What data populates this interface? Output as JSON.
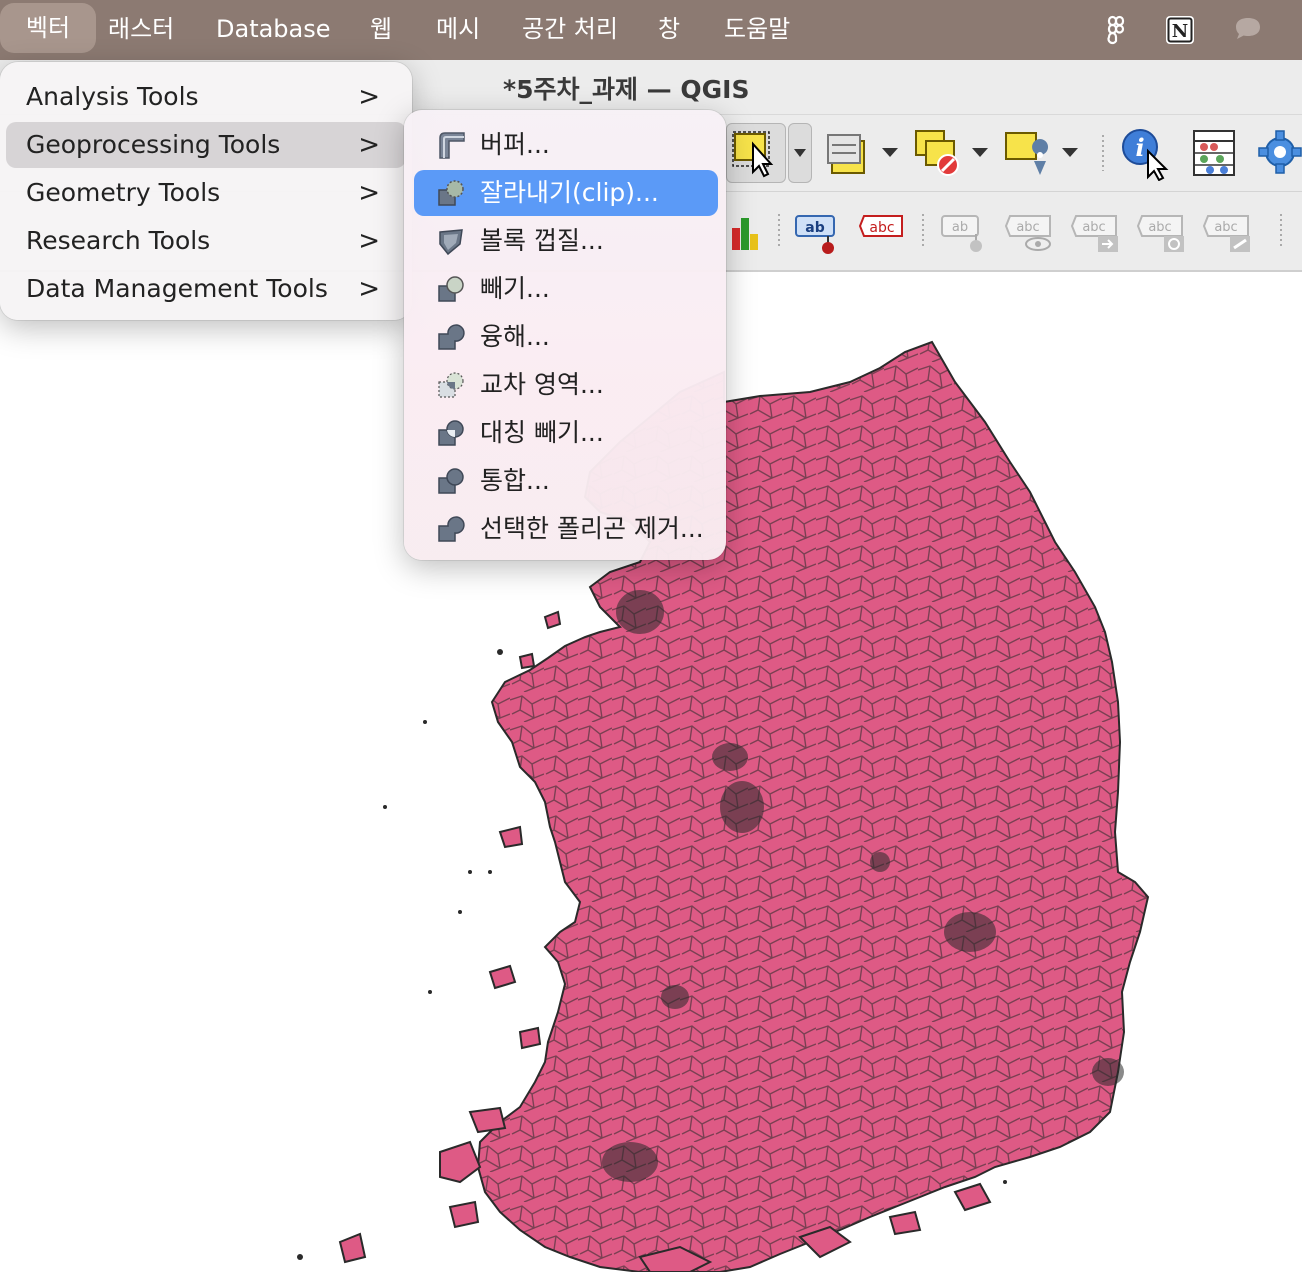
{
  "menubar": {
    "items": [
      {
        "label": "벡터",
        "active": true
      },
      {
        "label": "래스터"
      },
      {
        "label": "Database"
      },
      {
        "label": "웹"
      },
      {
        "label": "메시"
      },
      {
        "label": "공간 처리"
      },
      {
        "label": "창"
      },
      {
        "label": "도움말"
      }
    ],
    "right_icons": [
      "figma-icon",
      "notion-icon",
      "chat-bubble-icon"
    ]
  },
  "window": {
    "title": "*5주차_과제 — QGIS"
  },
  "vector_menu": {
    "items": [
      {
        "label": "Analysis Tools",
        "submenu": true
      },
      {
        "label": "Geoprocessing Tools",
        "submenu": true,
        "highlighted": true
      },
      {
        "label": "Geometry Tools",
        "submenu": true
      },
      {
        "label": "Research Tools",
        "submenu": true
      },
      {
        "label": "Data Management Tools",
        "submenu": true
      }
    ],
    "chevron": ">"
  },
  "geoprocessing_menu": {
    "items": [
      {
        "label": "버퍼...",
        "icon": "buffer-icon"
      },
      {
        "label": "잘라내기(clip)...",
        "icon": "clip-icon",
        "selected": true
      },
      {
        "label": "볼록 껍질...",
        "icon": "convex-hull-icon"
      },
      {
        "label": "빼기...",
        "icon": "difference-icon"
      },
      {
        "label": "융해...",
        "icon": "dissolve-icon"
      },
      {
        "label": "교차 영역...",
        "icon": "intersection-icon"
      },
      {
        "label": "대칭 빼기...",
        "icon": "symmetrical-difference-icon"
      },
      {
        "label": "통합...",
        "icon": "union-icon"
      },
      {
        "label": "선택한 폴리곤 제거...",
        "icon": "eliminate-polygons-icon"
      }
    ]
  },
  "toolbar2": {
    "label_icons": [
      "ab",
      "abc",
      "ab",
      "abc",
      "abc",
      "abc",
      "abc"
    ]
  },
  "colors": {
    "menubar_bg": "#8c7a72",
    "selection": "#5b9af7",
    "map_fill": "#de5a85",
    "map_stroke": "#2a2a2a"
  }
}
